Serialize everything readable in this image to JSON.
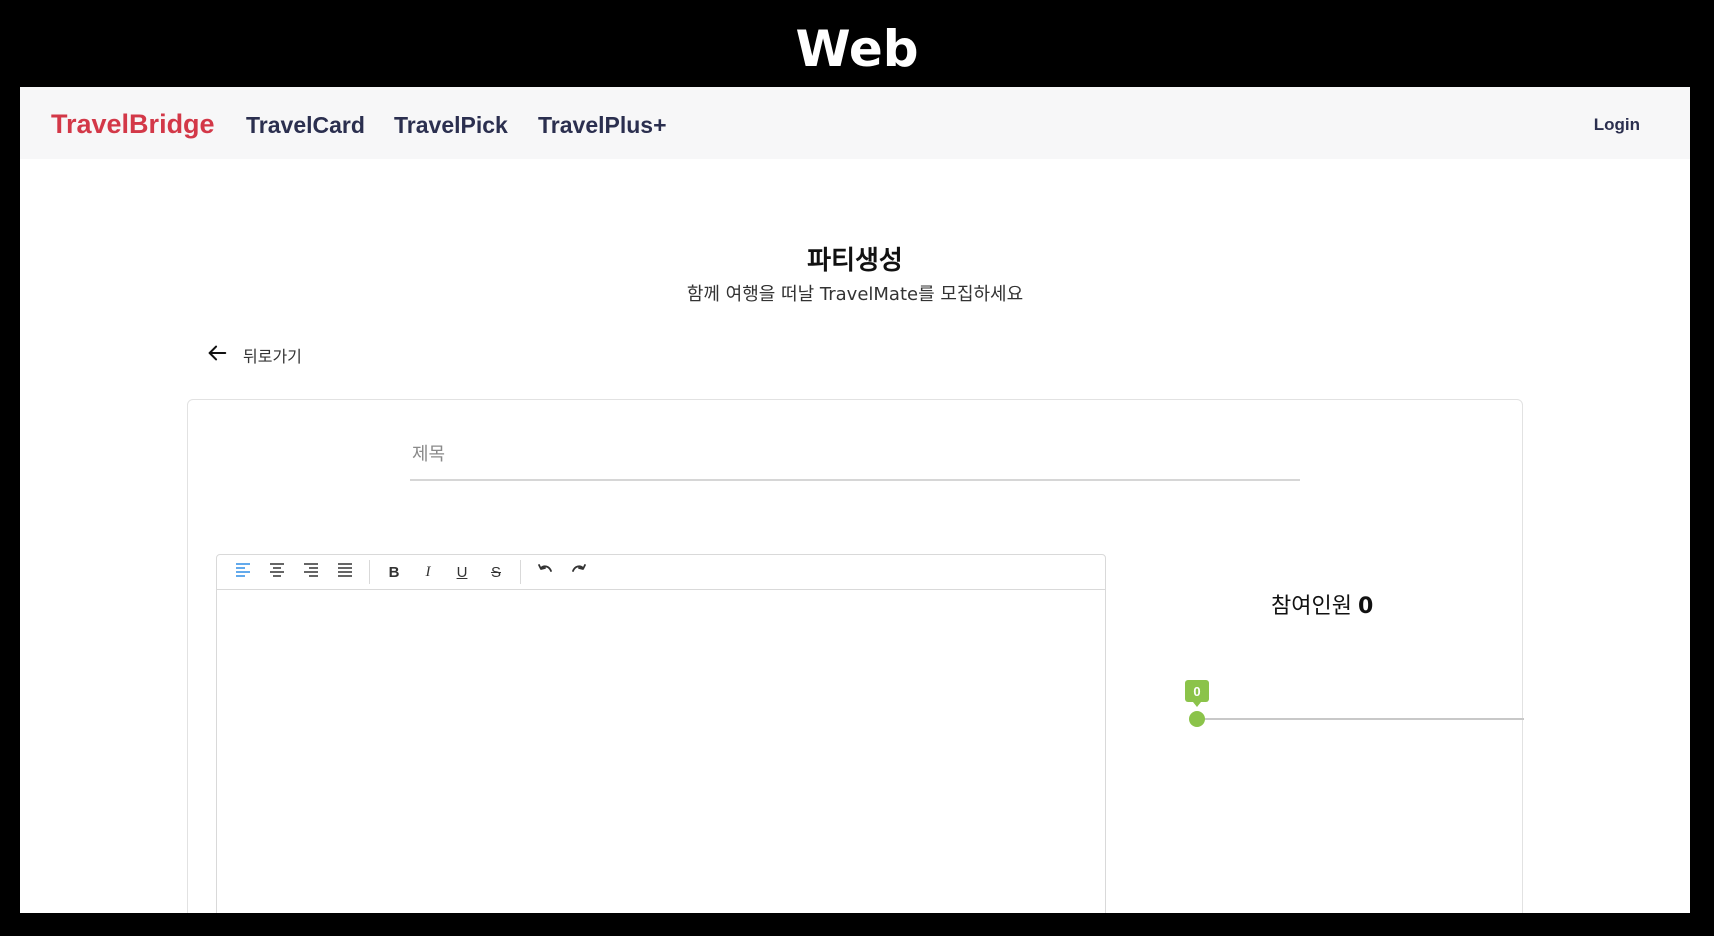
{
  "frame_label": "Web",
  "header": {
    "brand": "TravelBridge",
    "nav": [
      "TravelCard",
      "TravelPick",
      "TravelPlus+"
    ],
    "login": "Login"
  },
  "page": {
    "title": "파티생성",
    "subtitle": "함께 여행을 떠날 TravelMate를 모집하세요",
    "back_label": "뒤로가기"
  },
  "form": {
    "title_placeholder": "제목",
    "title_value": ""
  },
  "editor": {
    "toolbar": {
      "align": [
        "align-left-icon",
        "align-center-icon",
        "align-right-icon",
        "align-justify-icon"
      ],
      "format": [
        "B",
        "I",
        "U",
        "S"
      ],
      "history": [
        "undo-icon",
        "redo-icon"
      ],
      "active_color": "#2f8ee5"
    },
    "content": ""
  },
  "participants": {
    "label": "참여인원",
    "count": "0",
    "slider_value": "0",
    "slider_fraction": 0,
    "accent_color": "#8bc34a"
  },
  "colors": {
    "brand": "#d33848",
    "nav": "#2b2f4f"
  }
}
